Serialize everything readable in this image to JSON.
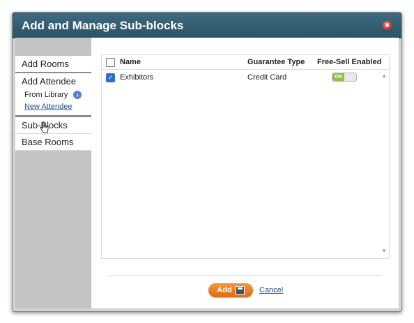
{
  "dialog": {
    "title": "Add and Manage Sub-blocks",
    "close_glyph": "✖"
  },
  "sidebar": {
    "add_rooms": "Add Rooms",
    "add_attendee": "Add Attendee",
    "from_library": "From Library",
    "new_attendee": "New Attendee",
    "sub_blocks": "Sub-Blocks",
    "base_rooms": "Base Rooms"
  },
  "grid": {
    "headers": {
      "name": "Name",
      "guarantee_type": "Guarantee Type",
      "free_sell": "Free-Sell Enabled"
    },
    "rows": [
      {
        "name": "Exhibitors",
        "guarantee_type": "Credit Card",
        "free_sell": "ON",
        "checked": true
      }
    ]
  },
  "footer": {
    "add_label": "Add",
    "cancel_label": "Cancel"
  },
  "colors": {
    "titlebar": "#2c5366",
    "add_button": "#e06a10",
    "toggle_on": "#8fbf52"
  },
  "icons": [
    "close-icon",
    "go-arrow-icon",
    "hand-cursor-icon",
    "save-icon",
    "checkbox-icon",
    "scroll-up-icon",
    "scroll-down-icon"
  ]
}
